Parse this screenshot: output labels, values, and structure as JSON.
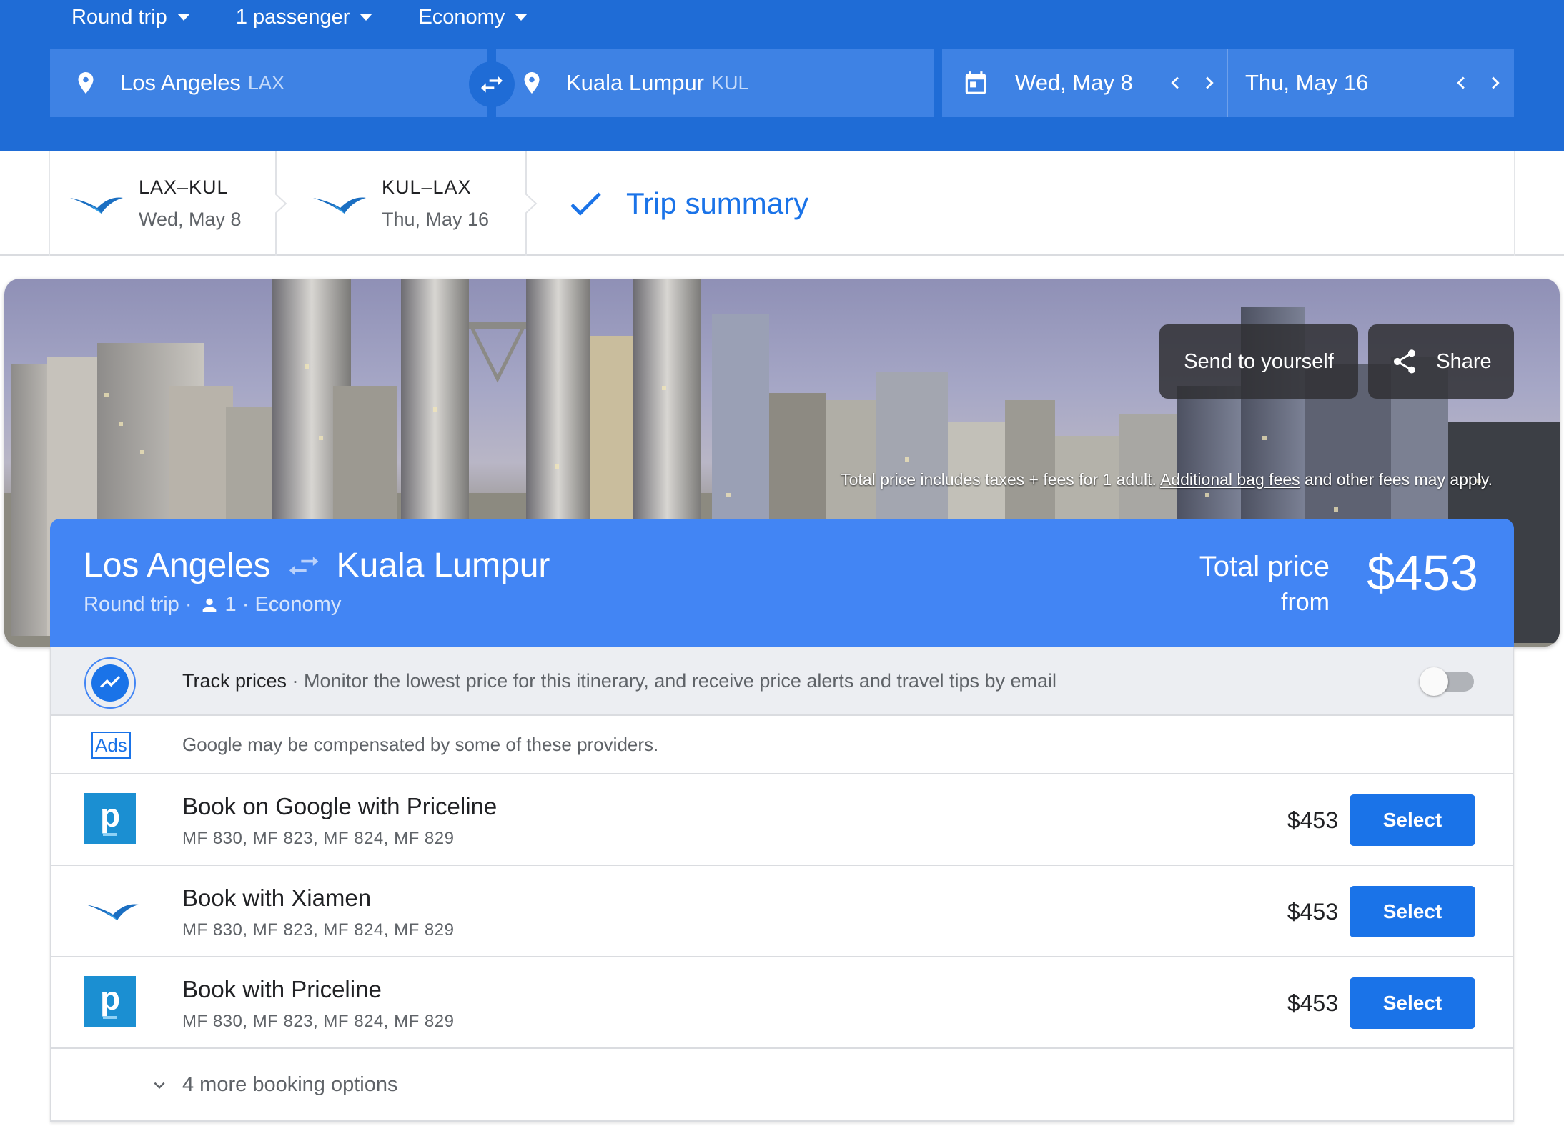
{
  "search": {
    "trip_type": "Round trip",
    "passengers": "1 passenger",
    "cabin": "Economy",
    "origin_city": "Los Angeles",
    "origin_code": "LAX",
    "destination_city": "Kuala Lumpur",
    "destination_code": "KUL",
    "depart_date": "Wed, May 8",
    "return_date": "Thu, May 16"
  },
  "tabs": [
    {
      "route": "LAX–KUL",
      "date": "Wed, May 8"
    },
    {
      "route": "KUL–LAX",
      "date": "Thu, May 16"
    }
  ],
  "summary_label": "Trip summary",
  "hero": {
    "send_label": "Send to yourself",
    "share_label": "Share",
    "disclaimer_pre": "Total price includes taxes + fees for 1 adult.",
    "disclaimer_link": "Additional bag fees",
    "disclaimer_post": "and other fees may apply."
  },
  "price_card": {
    "origin": "Los Angeles",
    "destination": "Kuala Lumpur",
    "trip_type": "Round trip",
    "passengers": "1",
    "cabin": "Economy",
    "total_label": "Total price",
    "from_label": "from",
    "total_price": "$453"
  },
  "track": {
    "title": "Track prices",
    "description": "Monitor the lowest price for this itinerary, and receive price alerts and travel tips by email",
    "enabled": false
  },
  "ads": {
    "badge": "Ads",
    "text": "Google may be compensated by some of these providers."
  },
  "options": [
    {
      "logo": "priceline-logo",
      "logo_letter": "p",
      "name": "Book on Google with Priceline",
      "flights": "MF 830, MF 823, MF 824, MF 829",
      "price": "$453",
      "button": "Select"
    },
    {
      "logo": "xiamen-logo",
      "logo_letter": "",
      "name": "Book with Xiamen",
      "flights": "MF 830, MF 823, MF 824, MF 829",
      "price": "$453",
      "button": "Select"
    },
    {
      "logo": "priceline-logo",
      "logo_letter": "p",
      "name": "Book with Priceline",
      "flights": "MF 830, MF 823, MF 824, MF 829",
      "price": "$453",
      "button": "Select"
    }
  ],
  "more_label": "4 more booking options",
  "colors": {
    "header_blue": "#1f6cd6",
    "field_blue": "#3e82e4",
    "card_blue": "#4285f4",
    "button_blue": "#1a73e8",
    "priceline_blue": "#1b8fd2"
  }
}
